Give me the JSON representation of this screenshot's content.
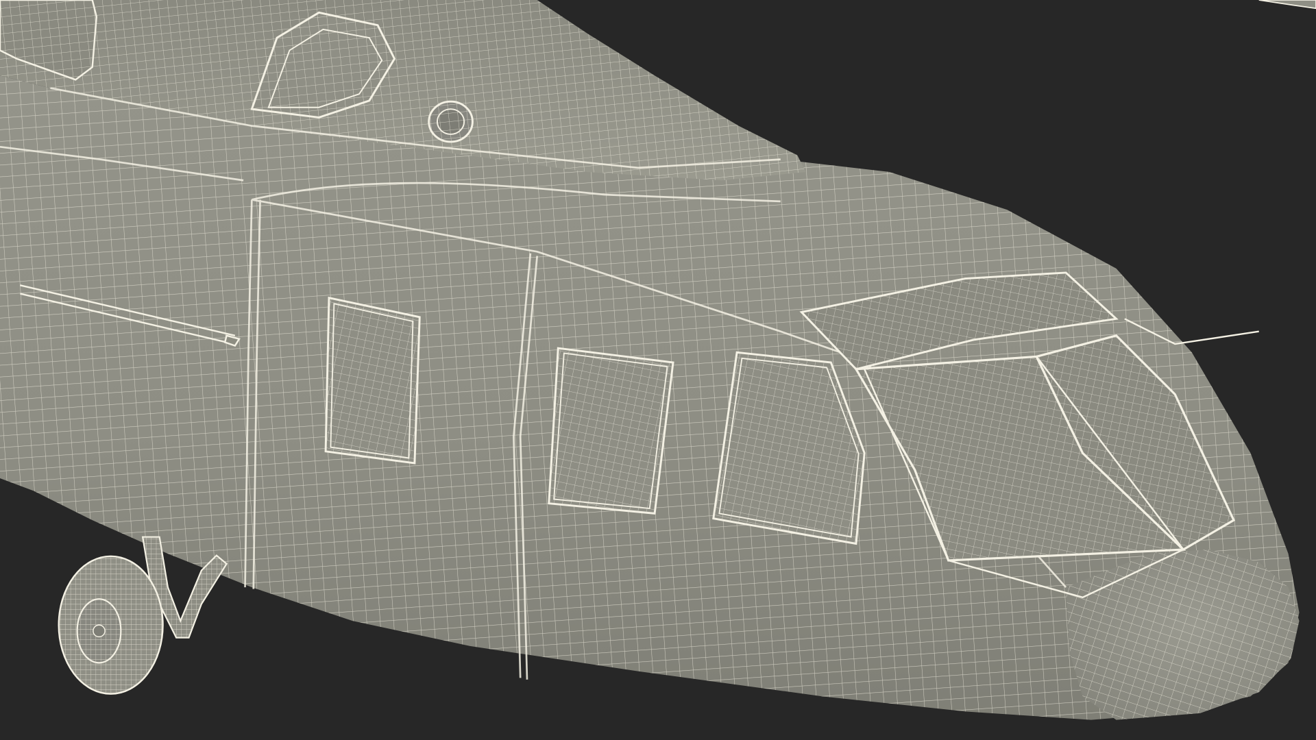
{
  "scene": {
    "subject": "helicopter-nose-wireframe",
    "background_color": "#272727",
    "surface_color": "#8d8d82",
    "wire_color": "#ece9dc",
    "seam_color": "#55554d"
  }
}
